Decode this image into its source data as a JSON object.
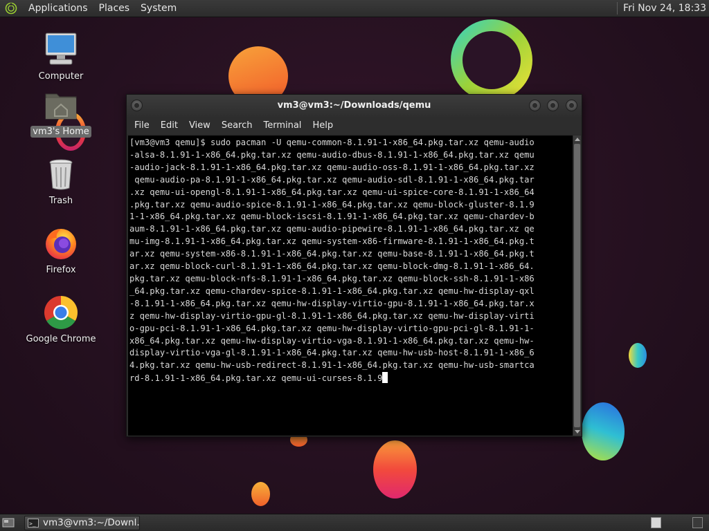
{
  "top_panel": {
    "menus": [
      "Applications",
      "Places",
      "System"
    ],
    "clock": "Fri Nov 24, 18:33"
  },
  "desktop_icons": {
    "computer": "Computer",
    "home": "vm3's Home",
    "trash": "Trash",
    "firefox": "Firefox",
    "chrome": "Google Chrome"
  },
  "terminal": {
    "title": "vm3@vm3:~/Downloads/qemu",
    "menus": [
      "File",
      "Edit",
      "View",
      "Search",
      "Terminal",
      "Help"
    ],
    "output_lines": [
      "[vm3@vm3 qemu]$ sudo pacman -U qemu-common-8.1.91-1-x86_64.pkg.tar.xz qemu-audio",
      "-alsa-8.1.91-1-x86_64.pkg.tar.xz qemu-audio-dbus-8.1.91-1-x86_64.pkg.tar.xz qemu",
      "-audio-jack-8.1.91-1-x86_64.pkg.tar.xz qemu-audio-oss-8.1.91-1-x86_64.pkg.tar.xz",
      " qemu-audio-pa-8.1.91-1-x86_64.pkg.tar.xz qemu-audio-sdl-8.1.91-1-x86_64.pkg.tar",
      ".xz qemu-ui-opengl-8.1.91-1-x86_64.pkg.tar.xz qemu-ui-spice-core-8.1.91-1-x86_64",
      ".pkg.tar.xz qemu-audio-spice-8.1.91-1-x86_64.pkg.tar.xz qemu-block-gluster-8.1.9",
      "1-1-x86_64.pkg.tar.xz qemu-block-iscsi-8.1.91-1-x86_64.pkg.tar.xz qemu-chardev-b",
      "aum-8.1.91-1-x86_64.pkg.tar.xz qemu-audio-pipewire-8.1.91-1-x86_64.pkg.tar.xz qe",
      "mu-img-8.1.91-1-x86_64.pkg.tar.xz qemu-system-x86-firmware-8.1.91-1-x86_64.pkg.t",
      "ar.xz qemu-system-x86-8.1.91-1-x86_64.pkg.tar.xz qemu-base-8.1.91-1-x86_64.pkg.t",
      "ar.xz qemu-block-curl-8.1.91-1-x86_64.pkg.tar.xz qemu-block-dmg-8.1.91-1-x86_64.",
      "pkg.tar.xz qemu-block-nfs-8.1.91-1-x86_64.pkg.tar.xz qemu-block-ssh-8.1.91-1-x86",
      "_64.pkg.tar.xz qemu-chardev-spice-8.1.91-1-x86_64.pkg.tar.xz qemu-hw-display-qxl",
      "-8.1.91-1-x86_64.pkg.tar.xz qemu-hw-display-virtio-gpu-8.1.91-1-x86_64.pkg.tar.x",
      "z qemu-hw-display-virtio-gpu-gl-8.1.91-1-x86_64.pkg.tar.xz qemu-hw-display-virti",
      "o-gpu-pci-8.1.91-1-x86_64.pkg.tar.xz qemu-hw-display-virtio-gpu-pci-gl-8.1.91-1-",
      "x86_64.pkg.tar.xz qemu-hw-display-virtio-vga-8.1.91-1-x86_64.pkg.tar.xz qemu-hw-",
      "display-virtio-vga-gl-8.1.91-1-x86_64.pkg.tar.xz qemu-hw-usb-host-8.1.91-1-x86_6",
      "4.pkg.tar.xz qemu-hw-usb-redirect-8.1.91-1-x86_64.pkg.tar.xz qemu-hw-usb-smartca",
      "rd-8.1.91-1-x86_64.pkg.tar.xz qemu-ui-curses-8.1.9"
    ]
  },
  "taskbar": {
    "task_label": "vm3@vm3:~/Downl..."
  },
  "colors": {
    "panel": "#2f2f2f",
    "terminal_bg": "#000000",
    "terminal_fg": "#d9d9d9",
    "desktop_bg": "#24101f"
  },
  "icons": [
    "distro-logo-icon",
    "computer-icon",
    "home-folder-icon",
    "trash-icon",
    "firefox-icon",
    "chrome-icon",
    "terminal-icon",
    "show-desktop-icon"
  ]
}
